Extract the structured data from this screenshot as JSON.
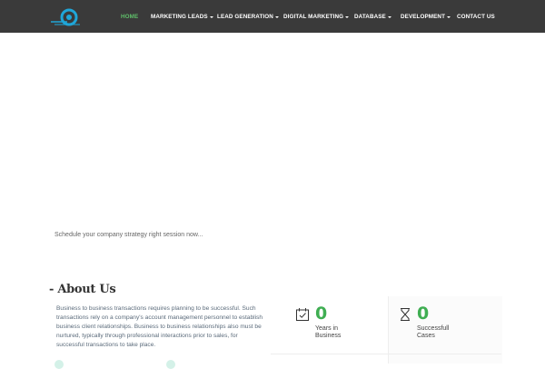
{
  "nav": {
    "items": [
      {
        "label": "HOME",
        "active": true,
        "dropdown": false
      },
      {
        "label": "MARKETING LEADS",
        "active": false,
        "dropdown": true
      },
      {
        "label": "LEAD GENERATION",
        "active": false,
        "dropdown": true
      },
      {
        "label": "DIGITAL MARKETING",
        "active": false,
        "dropdown": true
      },
      {
        "label": "DATABASE",
        "active": false,
        "dropdown": true
      },
      {
        "label": "DEVELOPMENT",
        "active": false,
        "dropdown": true
      },
      {
        "label": "CONTACT US",
        "active": false,
        "dropdown": false
      }
    ],
    "active_color": "#5fbf6a",
    "background": "#3a3a3a"
  },
  "hero": {
    "text": "Schedule your company strategy right session now..."
  },
  "about": {
    "title": "- About Us",
    "body": "Business to business transactions requires planning to be successful. Such transactions rely on a company's account management personnel to establish business client relationships. Business to business relationships also must be nurtured, typically through professional interactions prior to sales, for successful transactions to take place."
  },
  "stats": [
    {
      "icon": "calendar-check-icon",
      "value": "0",
      "line1": "Years in",
      "line2": "Business"
    },
    {
      "icon": "hourglass-icon",
      "value": "0",
      "line1": "Successfull",
      "line2": "Cases"
    }
  ],
  "accent_color": "#3fae52"
}
